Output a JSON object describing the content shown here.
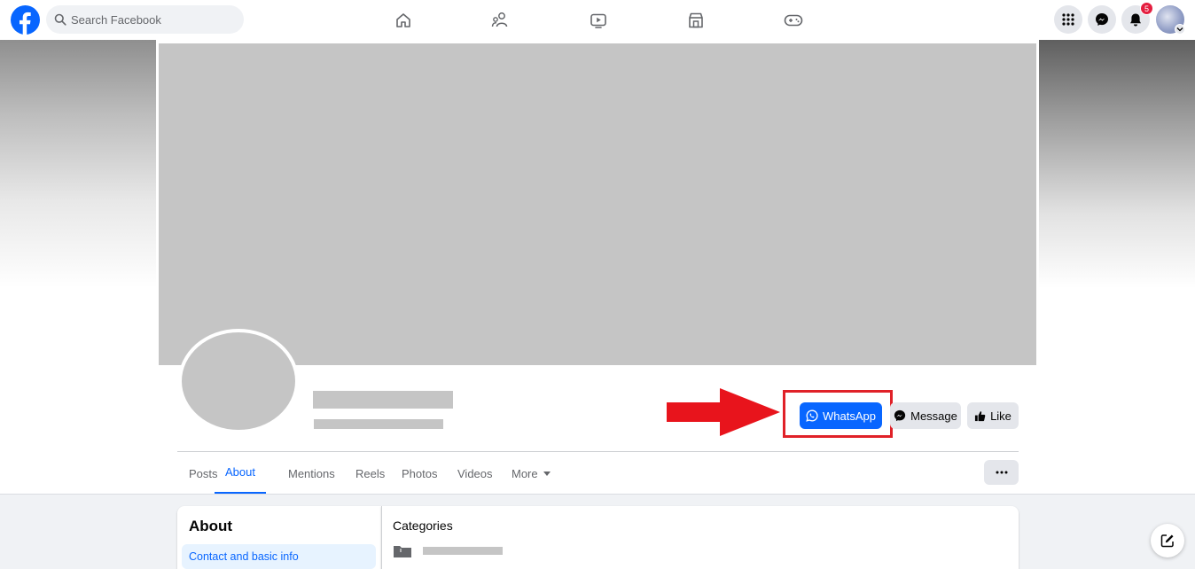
{
  "topbar": {
    "logo_icon": "facebook-logo-icon",
    "search_placeholder": "Search Facebook",
    "nav_icons": [
      "home-icon",
      "friends-icon",
      "video-icon",
      "marketplace-icon",
      "gaming-icon"
    ],
    "right_icons": [
      "menu-grid-icon",
      "messenger-icon",
      "bell-icon"
    ],
    "notification_count": "5"
  },
  "profile": {
    "actions": {
      "whatsapp_label": "WhatsApp",
      "message_label": "Message",
      "like_label": "Like"
    },
    "highlight_color": "#e02128",
    "accent_color": "#0866ff"
  },
  "tabs": {
    "items": [
      {
        "label": "Posts",
        "active": false
      },
      {
        "label": "About",
        "active": true
      },
      {
        "label": "Mentions",
        "active": false
      },
      {
        "label": "Reels",
        "active": false
      },
      {
        "label": "Photos",
        "active": false
      },
      {
        "label": "Videos",
        "active": false
      }
    ],
    "more_label": "More"
  },
  "about": {
    "title": "About",
    "selected_item": "Contact and basic info",
    "section_title": "Categories"
  }
}
